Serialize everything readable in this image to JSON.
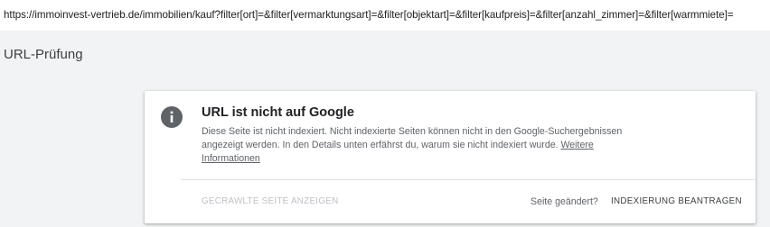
{
  "url_bar": {
    "text": "https://immoinvest-vertrieb.de/immobilien/kauf?filter[ort]=&filter[vermarktungsart]=&filter[objektart]=&filter[kaufpreis]=&filter[anzahl_zimmer]=&filter[warmmiete]="
  },
  "section": {
    "title": "URL-Prüfung"
  },
  "card": {
    "icon": "info-icon",
    "title": "URL ist nicht auf Google",
    "description": "Diese Seite ist nicht indexiert. Nicht indexierte Seiten können nicht in den Google-Suchergebnissen angezeigt werden. In den Details unten erfährst du, warum sie nicht indexiert wurde. ",
    "link_label": "Weitere Informationen",
    "crawled_button_label": "GECRAWLTE SEITE ANZEIGEN",
    "changed_label": "Seite geändert?",
    "request_button_label": "INDEXIERUNG BEANTRAGEN"
  },
  "colors": {
    "background": "#f1f3f4",
    "card": "#ffffff",
    "icon": "#5f6368",
    "disabled_text": "#bdc1c6",
    "secondary_text": "#5f6368"
  }
}
